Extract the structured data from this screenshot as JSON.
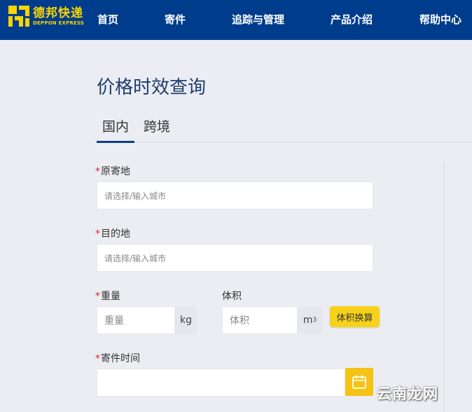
{
  "brand": {
    "name_cn": "德邦快递",
    "name_en": "DEPPON EXPRESS",
    "color": "#f8d500"
  },
  "nav": {
    "items": [
      {
        "label": "首页"
      },
      {
        "label": "寄件"
      },
      {
        "label": "追踪与管理"
      },
      {
        "label": "产品介绍"
      },
      {
        "label": "帮助中心"
      }
    ],
    "background": "#003c8c"
  },
  "page": {
    "title": "价格时效查询"
  },
  "tabs": [
    {
      "label": "国内",
      "active": true
    },
    {
      "label": "跨境",
      "active": false
    }
  ],
  "form": {
    "required_mark": "*",
    "origin": {
      "label": "原寄地",
      "placeholder": "请选择/输入城市",
      "value": ""
    },
    "destination": {
      "label": "目的地",
      "placeholder": "请选择/输入城市",
      "value": ""
    },
    "weight": {
      "label": "重量",
      "placeholder": "重量",
      "unit": "kg"
    },
    "volume": {
      "label": "体积",
      "placeholder": "体积",
      "unit": "m",
      "unit_sup": "3"
    },
    "volume_calc_button": "体积换算",
    "ship_time": {
      "label": "寄件时间",
      "value": ""
    },
    "calendar_icon": "calendar-icon"
  },
  "watermark": {
    "text": "云南龙网"
  }
}
